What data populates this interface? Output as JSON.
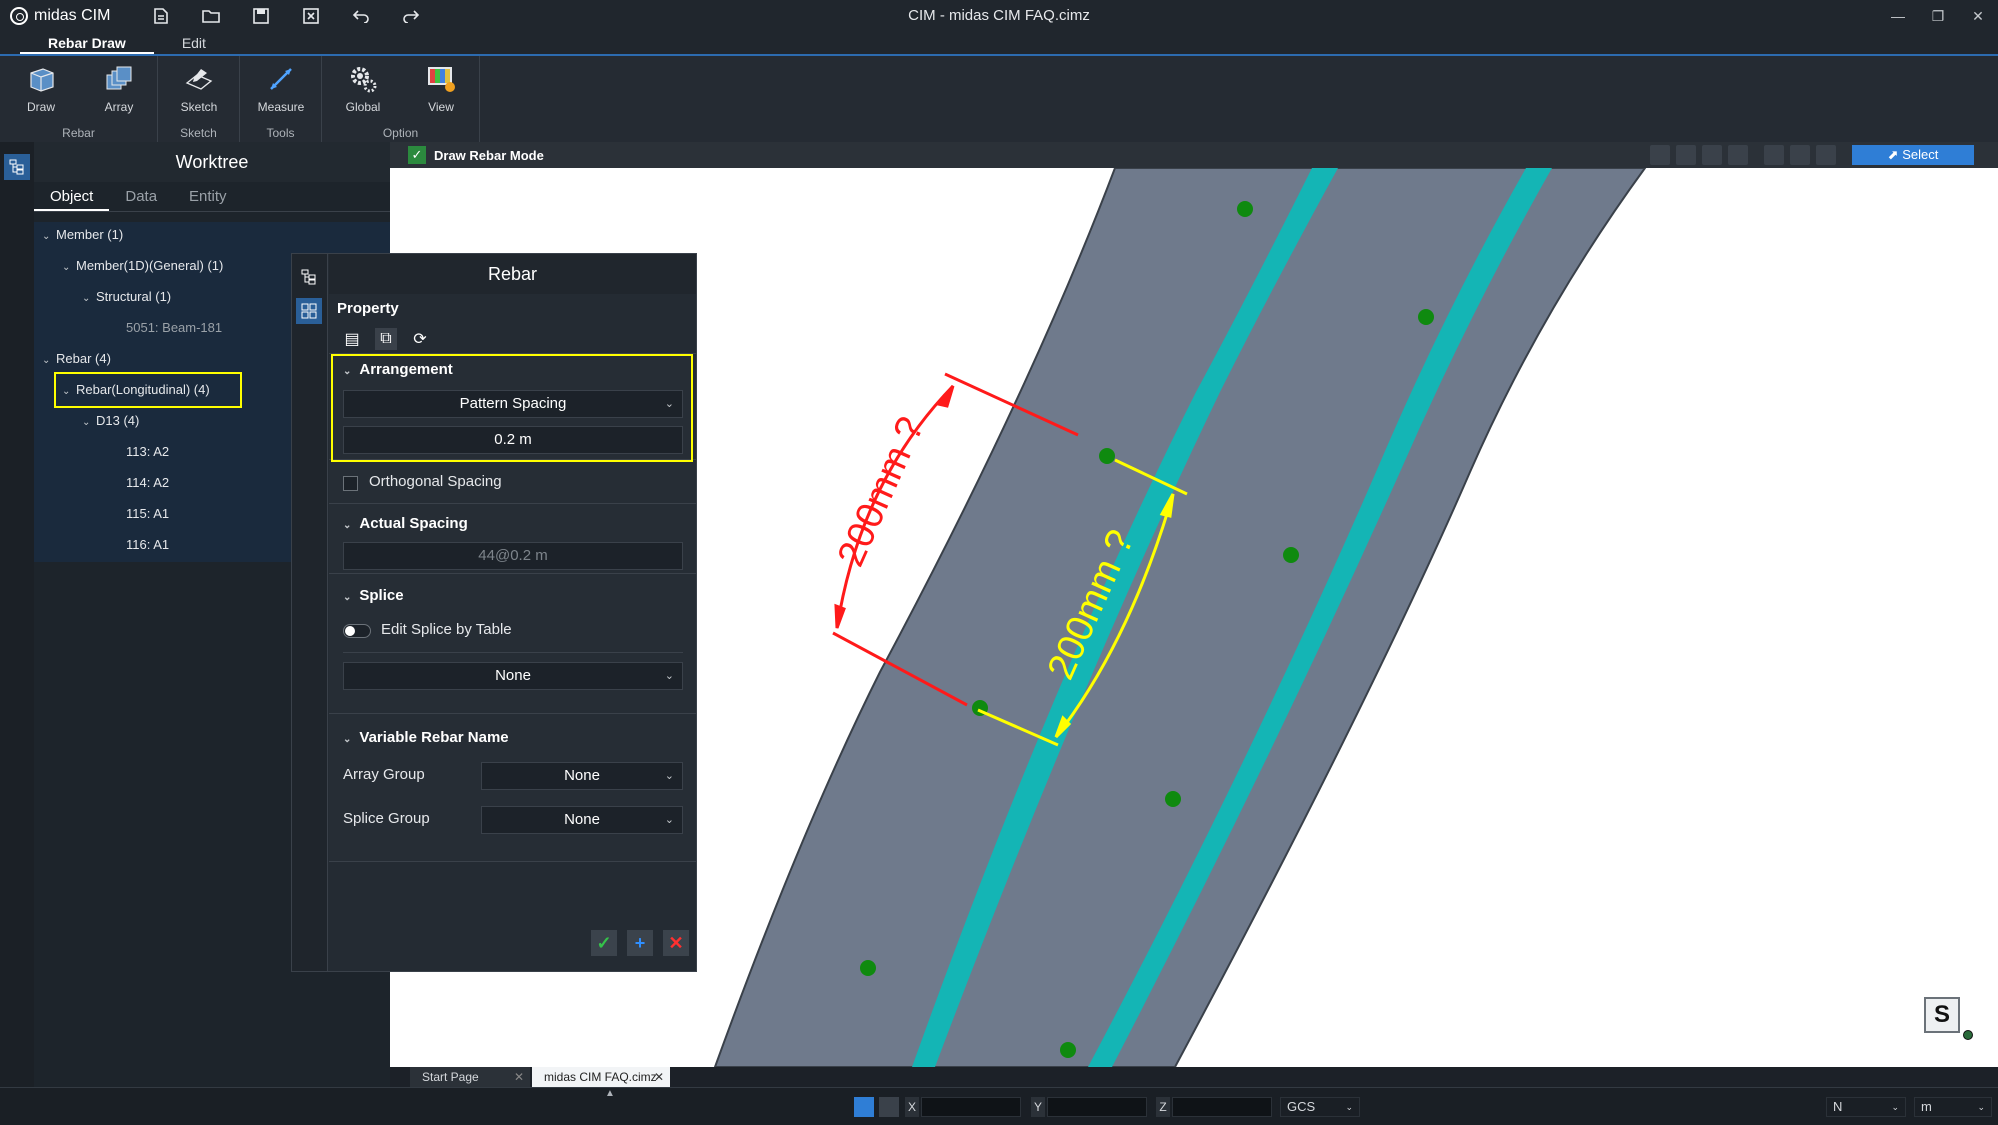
{
  "app": {
    "name": "midas CIM",
    "window_title": "CIM - midas CIM FAQ.cimz"
  },
  "quick_access": [
    "new-file-icon",
    "open-folder-icon",
    "save-icon",
    "close-file-icon",
    "undo-icon",
    "redo-icon"
  ],
  "window_controls": [
    "minimize-icon",
    "restore-icon",
    "close-icon"
  ],
  "ribbon_tabs": [
    {
      "label": "Rebar Draw",
      "active": true
    },
    {
      "label": "Edit",
      "active": false
    }
  ],
  "ribbon": {
    "groups": [
      {
        "label": "Rebar",
        "buttons": [
          {
            "label": "Draw",
            "icon": "draw-icon"
          },
          {
            "label": "Array",
            "icon": "array-icon"
          }
        ]
      },
      {
        "label": "Sketch",
        "buttons": [
          {
            "label": "Sketch",
            "icon": "sketch-icon"
          }
        ]
      },
      {
        "label": "Tools",
        "buttons": [
          {
            "label": "Measure",
            "icon": "measure-icon"
          }
        ]
      },
      {
        "label": "Option",
        "buttons": [
          {
            "label": "Global",
            "icon": "gear-icon"
          },
          {
            "label": "View",
            "icon": "view-icon"
          }
        ]
      }
    ]
  },
  "worktree": {
    "title": "Worktree",
    "tabs": [
      {
        "label": "Object",
        "active": true
      },
      {
        "label": "Data",
        "active": false
      },
      {
        "label": "Entity",
        "active": false
      }
    ],
    "nodes": [
      "Member (1)",
      "Member(1D)(General) (1)",
      "Structural (1)",
      "5051: Beam-181",
      "Rebar (4)",
      "Rebar(Longitudinal) (4)",
      "D13 (4)",
      "113: A2",
      "114: A2",
      "115: A1",
      "116: A1"
    ]
  },
  "viewport_toolbar": {
    "mode_label": "Draw Rebar Mode",
    "mode_checked": true,
    "select_label": "Select"
  },
  "rebar_panel": {
    "title": "Rebar",
    "property_label": "Property",
    "icons": [
      "table-icon",
      "copy-icon",
      "refresh-icon"
    ],
    "arrangement": {
      "header": "Arrangement",
      "type": "Pattern Spacing",
      "spacing": "0.2 m"
    },
    "orthogonal_spacing": {
      "label": "Orthogonal Spacing",
      "checked": false
    },
    "actual_spacing": {
      "header": "Actual Spacing",
      "value": "44@0.2 m"
    },
    "splice": {
      "header": "Splice",
      "toggle_label": "Edit Splice by Table",
      "toggle_on": false,
      "value": "None"
    },
    "variable_rebar_name": {
      "header": "Variable Rebar Name",
      "array_group_label": "Array Group",
      "array_group_value": "None",
      "splice_group_label": "Splice Group",
      "splice_group_value": "None"
    },
    "actions": [
      "apply-check-icon",
      "add-icon",
      "cancel-icon"
    ]
  },
  "annotations": {
    "red_label": "200mm ?",
    "yellow_label": "200mm ?"
  },
  "doc_tabs": [
    {
      "label": "Start Page",
      "active": false
    },
    {
      "label": "midas CIM FAQ.cimz",
      "active": true
    }
  ],
  "statusbar": {
    "x_label": "X",
    "y_label": "Y",
    "z_label": "Z",
    "cs": "GCS",
    "force_unit": "N",
    "length_unit": "m"
  },
  "view_cube_label": "S",
  "colors": {
    "accent": "#2f7ed6",
    "highlight": "#ffff00",
    "rebar": "#14b5b5",
    "concrete": "#6f7a8c",
    "point": "#0f8a0f"
  }
}
